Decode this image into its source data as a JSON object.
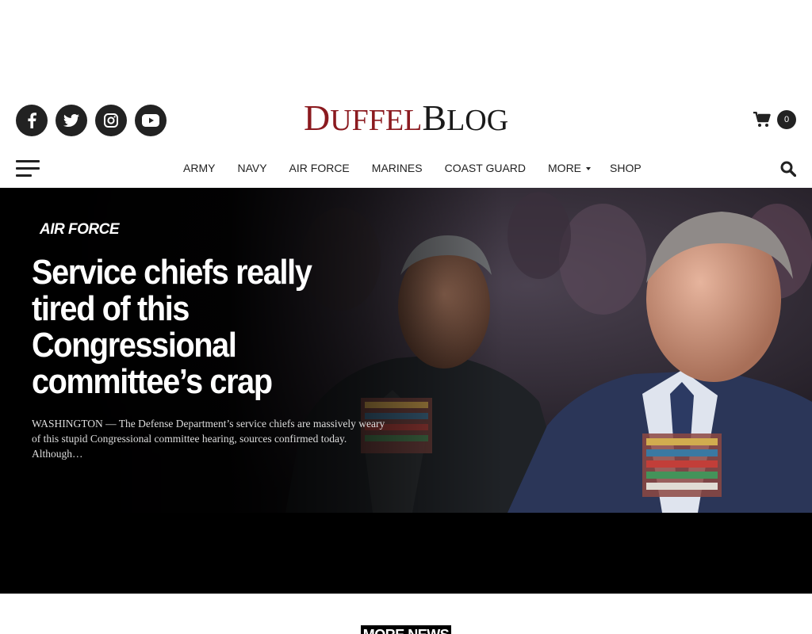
{
  "brand": {
    "logo_big_1": "D",
    "logo_small_1": "UFFEL",
    "logo_big_2": "B",
    "logo_small_2": "LOG",
    "accent_color": "#8b1a1f"
  },
  "social": [
    {
      "icon": "facebook-icon"
    },
    {
      "icon": "twitter-icon"
    },
    {
      "icon": "instagram-icon"
    },
    {
      "icon": "youtube-icon"
    }
  ],
  "cart": {
    "icon": "shopping-cart-icon",
    "count": "0"
  },
  "nav": {
    "items": [
      "ARMY",
      "NAVY",
      "AIR FORCE",
      "MARINES",
      "COAST GUARD",
      "MORE",
      "SHOP"
    ],
    "menu_icon": "hamburger-menu-icon",
    "search_icon": "search-icon"
  },
  "hero": {
    "category": "AIR FORCE",
    "title": "Service chiefs really tired of this Congressional committee’s crap",
    "excerpt": "WASHINGTON — The Defense Department’s service chiefs are massively weary of this stupid Congressional committee hearing, sources confirmed today.  Although…"
  },
  "section": {
    "more_news": "MORE NEWS"
  }
}
